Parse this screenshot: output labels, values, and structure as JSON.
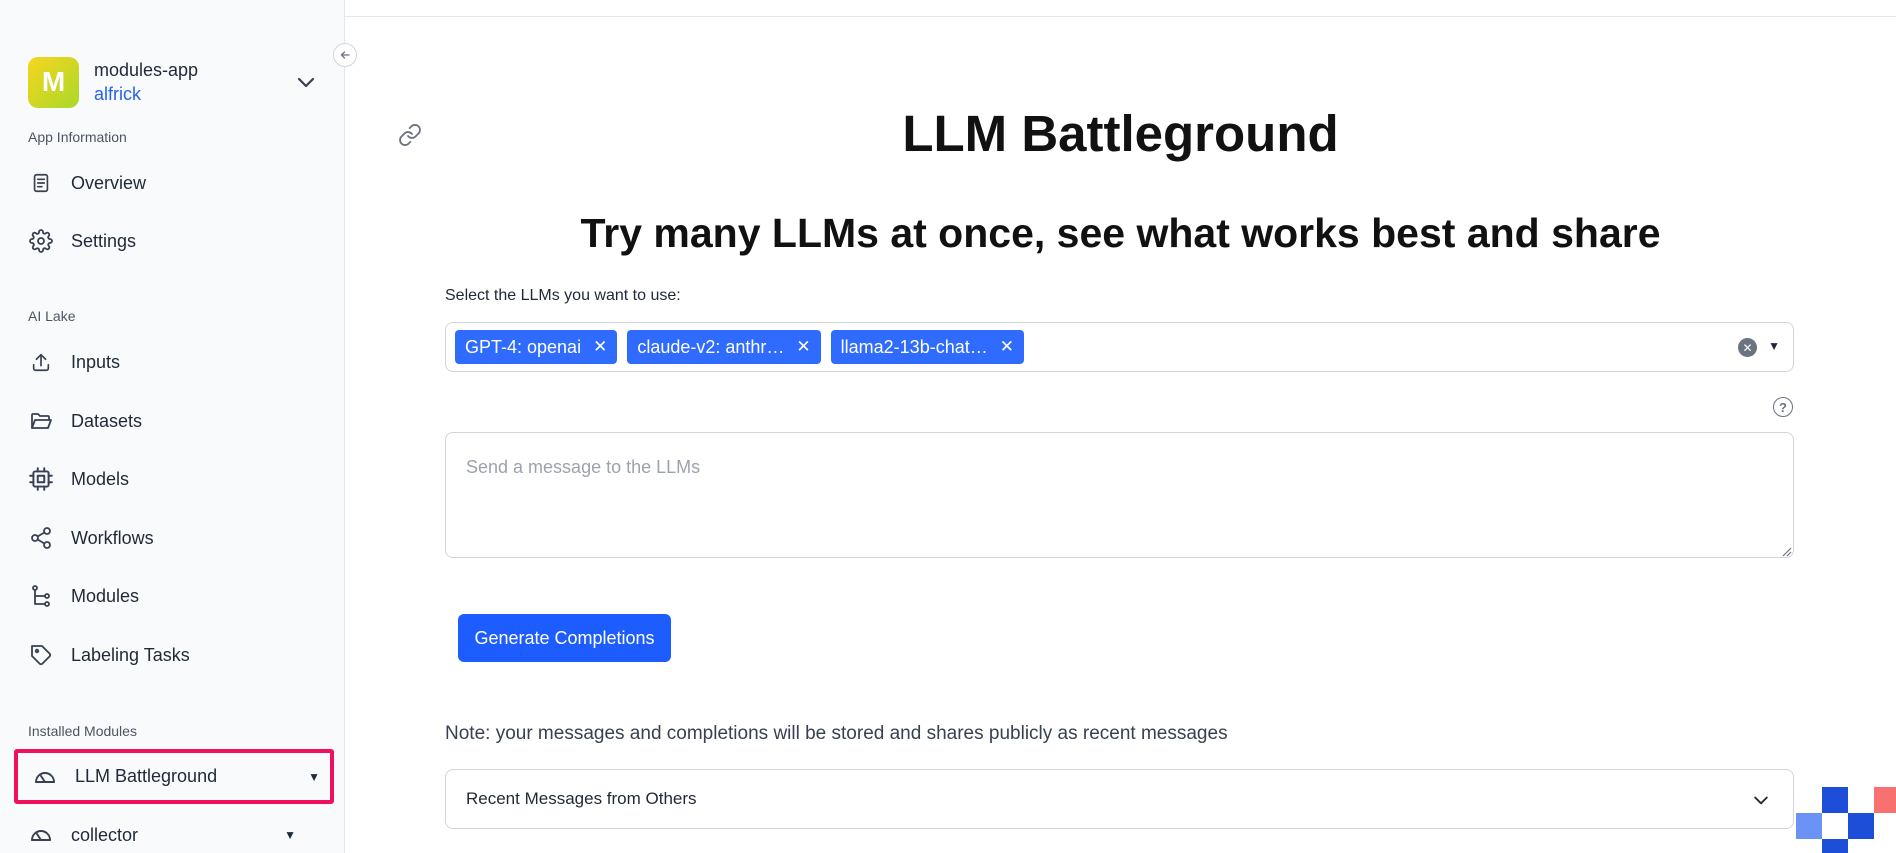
{
  "app": {
    "avatar_letter": "M",
    "name": "modules-app",
    "user": "alfrick"
  },
  "sidebar": {
    "sections": {
      "app_information": "App Information",
      "ai_lake": "AI Lake",
      "installed_modules": "Installed Modules"
    },
    "app_info_items": [
      {
        "label": "Overview",
        "icon": "document-icon"
      },
      {
        "label": "Settings",
        "icon": "gear-icon"
      }
    ],
    "ai_lake_items": [
      {
        "label": "Inputs",
        "icon": "upload-icon"
      },
      {
        "label": "Datasets",
        "icon": "folder-icon"
      },
      {
        "label": "Models",
        "icon": "chip-icon"
      },
      {
        "label": "Workflows",
        "icon": "share-nodes-icon"
      },
      {
        "label": "Modules",
        "icon": "tree-icon"
      },
      {
        "label": "Labeling Tasks",
        "icon": "tag-icon"
      }
    ],
    "installed_modules": [
      {
        "label": "LLM Battleground",
        "icon": "gauge-icon",
        "active": true
      },
      {
        "label": "collector",
        "icon": "gauge-icon",
        "active": false
      }
    ]
  },
  "main": {
    "title": "LLM Battleground",
    "subtitle": "Try many LLMs at once, see what works best and share",
    "select_label": "Select the LLMs you want to use:",
    "selected_llms": [
      "GPT-4: openai",
      "claude-v2: anthr…",
      "llama2-13b-chat…"
    ],
    "message_placeholder": "Send a message to the LLMs",
    "generate_button": "Generate Completions",
    "note": "Note: your messages and completions will be stored and shares publicly as recent messages",
    "recent_messages_label": "Recent Messages from Others"
  },
  "colors": {
    "accent": "#1d5cff",
    "chip": "#2f6bff",
    "highlight_border": "#f0115c"
  }
}
